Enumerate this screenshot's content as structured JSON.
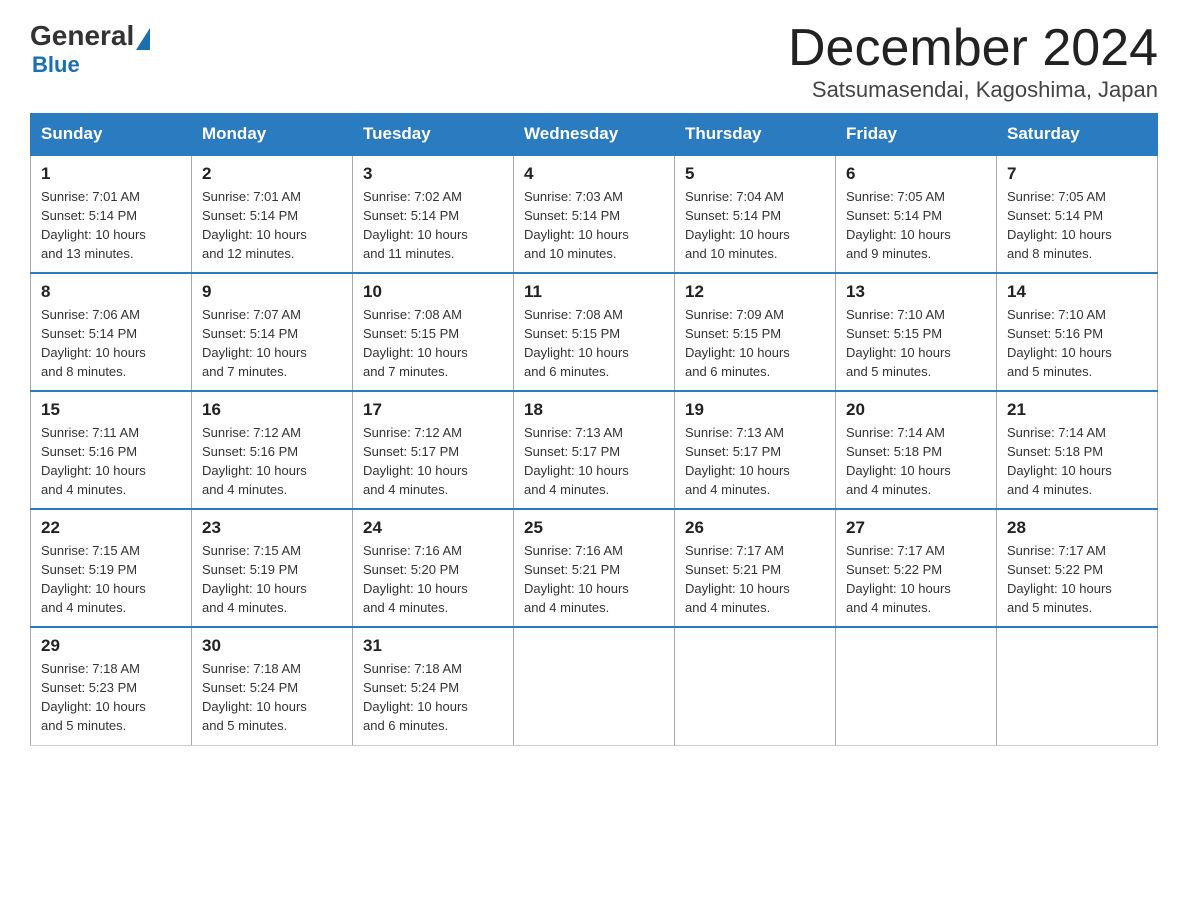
{
  "header": {
    "logo_general": "General",
    "logo_blue": "Blue",
    "month_title": "December 2024",
    "subtitle": "Satsumasendai, Kagoshima, Japan"
  },
  "days_of_week": [
    "Sunday",
    "Monday",
    "Tuesday",
    "Wednesday",
    "Thursday",
    "Friday",
    "Saturday"
  ],
  "weeks": [
    [
      {
        "day": "1",
        "sunrise": "7:01 AM",
        "sunset": "5:14 PM",
        "daylight": "10 hours and 13 minutes."
      },
      {
        "day": "2",
        "sunrise": "7:01 AM",
        "sunset": "5:14 PM",
        "daylight": "10 hours and 12 minutes."
      },
      {
        "day": "3",
        "sunrise": "7:02 AM",
        "sunset": "5:14 PM",
        "daylight": "10 hours and 11 minutes."
      },
      {
        "day": "4",
        "sunrise": "7:03 AM",
        "sunset": "5:14 PM",
        "daylight": "10 hours and 10 minutes."
      },
      {
        "day": "5",
        "sunrise": "7:04 AM",
        "sunset": "5:14 PM",
        "daylight": "10 hours and 10 minutes."
      },
      {
        "day": "6",
        "sunrise": "7:05 AM",
        "sunset": "5:14 PM",
        "daylight": "10 hours and 9 minutes."
      },
      {
        "day": "7",
        "sunrise": "7:05 AM",
        "sunset": "5:14 PM",
        "daylight": "10 hours and 8 minutes."
      }
    ],
    [
      {
        "day": "8",
        "sunrise": "7:06 AM",
        "sunset": "5:14 PM",
        "daylight": "10 hours and 8 minutes."
      },
      {
        "day": "9",
        "sunrise": "7:07 AM",
        "sunset": "5:14 PM",
        "daylight": "10 hours and 7 minutes."
      },
      {
        "day": "10",
        "sunrise": "7:08 AM",
        "sunset": "5:15 PM",
        "daylight": "10 hours and 7 minutes."
      },
      {
        "day": "11",
        "sunrise": "7:08 AM",
        "sunset": "5:15 PM",
        "daylight": "10 hours and 6 minutes."
      },
      {
        "day": "12",
        "sunrise": "7:09 AM",
        "sunset": "5:15 PM",
        "daylight": "10 hours and 6 minutes."
      },
      {
        "day": "13",
        "sunrise": "7:10 AM",
        "sunset": "5:15 PM",
        "daylight": "10 hours and 5 minutes."
      },
      {
        "day": "14",
        "sunrise": "7:10 AM",
        "sunset": "5:16 PM",
        "daylight": "10 hours and 5 minutes."
      }
    ],
    [
      {
        "day": "15",
        "sunrise": "7:11 AM",
        "sunset": "5:16 PM",
        "daylight": "10 hours and 4 minutes."
      },
      {
        "day": "16",
        "sunrise": "7:12 AM",
        "sunset": "5:16 PM",
        "daylight": "10 hours and 4 minutes."
      },
      {
        "day": "17",
        "sunrise": "7:12 AM",
        "sunset": "5:17 PM",
        "daylight": "10 hours and 4 minutes."
      },
      {
        "day": "18",
        "sunrise": "7:13 AM",
        "sunset": "5:17 PM",
        "daylight": "10 hours and 4 minutes."
      },
      {
        "day": "19",
        "sunrise": "7:13 AM",
        "sunset": "5:17 PM",
        "daylight": "10 hours and 4 minutes."
      },
      {
        "day": "20",
        "sunrise": "7:14 AM",
        "sunset": "5:18 PM",
        "daylight": "10 hours and 4 minutes."
      },
      {
        "day": "21",
        "sunrise": "7:14 AM",
        "sunset": "5:18 PM",
        "daylight": "10 hours and 4 minutes."
      }
    ],
    [
      {
        "day": "22",
        "sunrise": "7:15 AM",
        "sunset": "5:19 PM",
        "daylight": "10 hours and 4 minutes."
      },
      {
        "day": "23",
        "sunrise": "7:15 AM",
        "sunset": "5:19 PM",
        "daylight": "10 hours and 4 minutes."
      },
      {
        "day": "24",
        "sunrise": "7:16 AM",
        "sunset": "5:20 PM",
        "daylight": "10 hours and 4 minutes."
      },
      {
        "day": "25",
        "sunrise": "7:16 AM",
        "sunset": "5:21 PM",
        "daylight": "10 hours and 4 minutes."
      },
      {
        "day": "26",
        "sunrise": "7:17 AM",
        "sunset": "5:21 PM",
        "daylight": "10 hours and 4 minutes."
      },
      {
        "day": "27",
        "sunrise": "7:17 AM",
        "sunset": "5:22 PM",
        "daylight": "10 hours and 4 minutes."
      },
      {
        "day": "28",
        "sunrise": "7:17 AM",
        "sunset": "5:22 PM",
        "daylight": "10 hours and 5 minutes."
      }
    ],
    [
      {
        "day": "29",
        "sunrise": "7:18 AM",
        "sunset": "5:23 PM",
        "daylight": "10 hours and 5 minutes."
      },
      {
        "day": "30",
        "sunrise": "7:18 AM",
        "sunset": "5:24 PM",
        "daylight": "10 hours and 5 minutes."
      },
      {
        "day": "31",
        "sunrise": "7:18 AM",
        "sunset": "5:24 PM",
        "daylight": "10 hours and 6 minutes."
      },
      null,
      null,
      null,
      null
    ]
  ],
  "labels": {
    "sunrise": "Sunrise: ",
    "sunset": "Sunset: ",
    "daylight": "Daylight: "
  }
}
